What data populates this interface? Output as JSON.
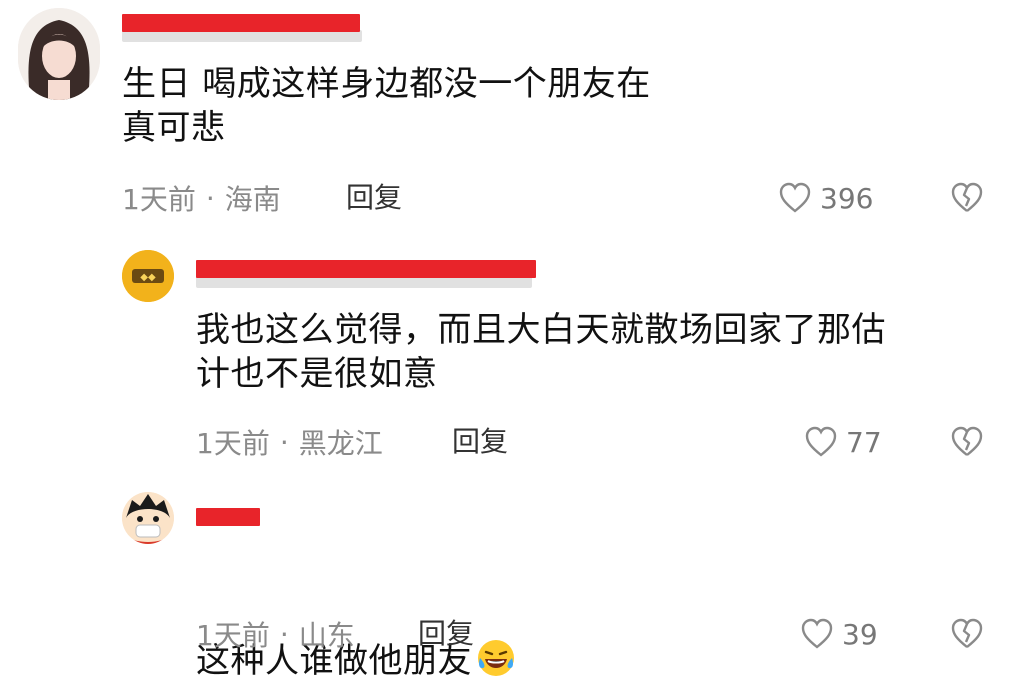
{
  "comments": [
    {
      "text": "生日 喝成这样身边都没一个朋友在\n真可悲",
      "time": "1天前",
      "location": "海南",
      "reply_label": "回复",
      "likes": "396"
    },
    {
      "text": "我也这么觉得，而且大白天就散场回家了那估\n计也不是很如意",
      "time": "1天前",
      "location": "黑龙江",
      "reply_label": "回复",
      "likes": "77"
    },
    {
      "text": "这种人谁做他朋友",
      "time": "1天前",
      "location": "山东",
      "reply_label": "回复",
      "likes": "39",
      "emoji": "laughing-crying-emoji"
    }
  ],
  "separator": "·",
  "colors": {
    "redaction": "#e8242a",
    "text": "#111111",
    "meta": "#8a8a8a"
  }
}
